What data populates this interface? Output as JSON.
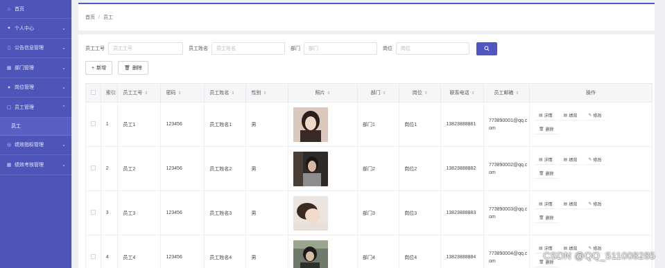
{
  "sidebar": {
    "home": "首页",
    "items": [
      {
        "label": "个人中心",
        "icon": "user-icon",
        "expanded": false
      },
      {
        "label": "公告信息管理",
        "icon": "notice-icon",
        "expanded": false
      },
      {
        "label": "部门管理",
        "icon": "department-icon",
        "expanded": false
      },
      {
        "label": "岗位管理",
        "icon": "position-icon",
        "expanded": false
      },
      {
        "label": "员工管理",
        "icon": "employee-icon",
        "expanded": true
      },
      {
        "label": "绩效指标管理",
        "icon": "target-icon",
        "expanded": false
      },
      {
        "label": "绩效考核管理",
        "icon": "evaluation-icon",
        "expanded": false
      }
    ],
    "active_sub": "员工"
  },
  "breadcrumb": {
    "home": "首页",
    "current": "员工"
  },
  "filters": {
    "emp_no": {
      "label": "员工工号",
      "placeholder": "员工工号"
    },
    "emp_name": {
      "label": "员工姓名",
      "placeholder": "员工姓名"
    },
    "dept": {
      "label": "部门",
      "placeholder": "部门"
    },
    "post": {
      "label": "岗位",
      "placeholder": "岗位"
    }
  },
  "actions": {
    "add": "新增",
    "delete": "删除"
  },
  "table": {
    "headers": [
      "索引",
      "员工工号",
      "密码",
      "员工姓名",
      "性别",
      "照片",
      "部门",
      "岗位",
      "联系电话",
      "员工邮箱",
      "操作"
    ],
    "rows": [
      {
        "idx": "1",
        "no": "员工1",
        "pwd": "123456",
        "name": "员工姓名1",
        "sex": "男",
        "dept": "部门1",
        "post": "岗位1",
        "phone": "13823888881",
        "email": "773890001@qq.com"
      },
      {
        "idx": "2",
        "no": "员工2",
        "pwd": "123456",
        "name": "员工姓名2",
        "sex": "男",
        "dept": "部门2",
        "post": "岗位2",
        "phone": "13823888882",
        "email": "773890002@qq.com"
      },
      {
        "idx": "3",
        "no": "员工3",
        "pwd": "123456",
        "name": "员工姓名3",
        "sex": "男",
        "dept": "部门3",
        "post": "岗位3",
        "phone": "13823888883",
        "email": "773890003@qq.com"
      },
      {
        "idx": "4",
        "no": "员工4",
        "pwd": "123456",
        "name": "员工姓名4",
        "sex": "男",
        "dept": "部门4",
        "post": "岗位4",
        "phone": "13823888884",
        "email": "773890004@qq.com"
      }
    ],
    "op_labels": {
      "detail": "详情",
      "perf": "绩效",
      "edit": "修改",
      "delete": "删除"
    }
  },
  "watermark": "CSDN @QQ_511008285",
  "colors": {
    "primary": "#5055c2",
    "sidebar": "#4f54b8"
  }
}
